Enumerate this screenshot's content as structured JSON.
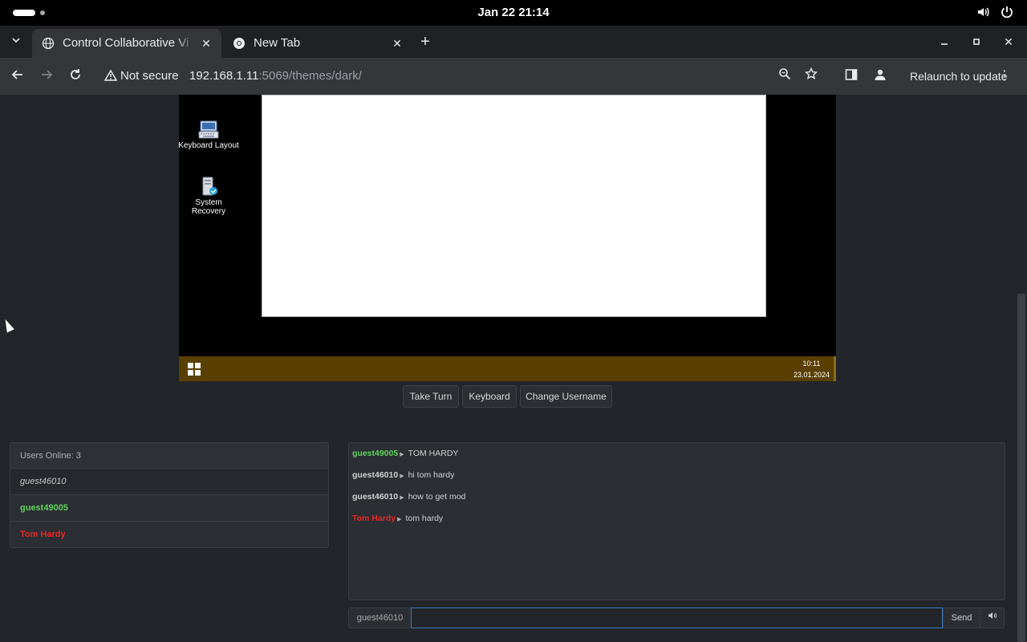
{
  "system_bar": {
    "clock": "Jan 22  21:14",
    "icons": [
      "volume-icon",
      "power-icon"
    ]
  },
  "browser": {
    "tabs": [
      {
        "title": "Control Collaborative Vi",
        "active": true,
        "favicon": "globe-icon"
      },
      {
        "title": "New Tab",
        "active": false,
        "favicon": "chrome-icon"
      }
    ],
    "address": {
      "security_label": "Not secure",
      "host": "192.168.1.11",
      "path": ":5069/themes/dark/"
    },
    "relaunch_label": "Relaunch to update"
  },
  "vm": {
    "desktop_icons": [
      {
        "label": "Keyboard Layout",
        "icon": "keyboard-icon"
      },
      {
        "label": "System Recovery",
        "icon": "recovery-icon"
      }
    ],
    "taskbar": {
      "time": "10:11",
      "date": "23.01.2024",
      "color": "#5a3f02"
    }
  },
  "controls": {
    "take_turn": "Take Turn",
    "keyboard": "Keyboard",
    "change_username": "Change Username"
  },
  "users": {
    "header": "Users Online: 3",
    "list": [
      {
        "name": "guest46010",
        "style": "me"
      },
      {
        "name": "guest49005",
        "style": "green"
      },
      {
        "name": "Tom Hardy",
        "style": "red"
      }
    ]
  },
  "chat": {
    "messages": [
      {
        "user": "guest49005",
        "text": "TOM HARDY",
        "color": "#5fd35f"
      },
      {
        "user": "guest46010",
        "text": "hi tom hardy",
        "color": "#d0d0d0"
      },
      {
        "user": "guest46010",
        "text": "how to get mod",
        "color": "#d0d0d0"
      },
      {
        "user": "Tom Hardy",
        "text": "tom hardy",
        "color": "#e82727"
      }
    ],
    "username": "guest46010",
    "input_value": "",
    "send_label": "Send",
    "volume_icon": "speaker-icon"
  }
}
